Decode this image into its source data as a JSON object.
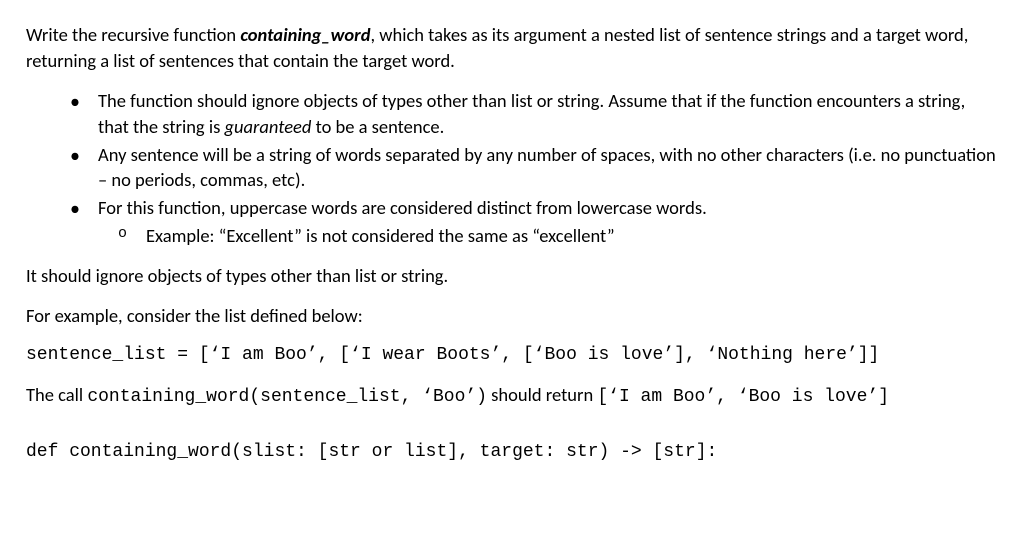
{
  "intro": {
    "pre": "Write the recursive function ",
    "fn_name": "containing_word",
    "post": ", which takes as its argument a nested list of sentence strings and a target word, returning a list of sentences that contain the target word."
  },
  "bullets": [
    {
      "pre": "The function should ignore objects of types other than list or string. Assume that if the function encounters a string, that the string is ",
      "italic": "guaranteed",
      "post": " to be a sentence."
    },
    {
      "text": "Any sentence will be a string of words separated by any number of spaces, with no other characters (i.e. no punctuation – no periods, commas, etc)."
    },
    {
      "text": "For this function, uppercase words are considered distinct from lowercase words.",
      "sub": "Example: “Excellent” is not considered the same as “excellent”"
    }
  ],
  "ignore_line": "It should ignore objects of types other than list or string.",
  "example_intro": "For example, consider the list defined below:",
  "code_def": "sentence_list = [‘I am Boo’, [‘I wear Boots’, [‘Boo is love’], ‘Nothing here’]]",
  "call_line": {
    "pre": "The call ",
    "call_code": "containing_word(sentence_list, ‘Boo’)",
    "mid": " should return ",
    "ret_code": "[‘I am Boo’, ‘Boo is love’]"
  },
  "fn_sig": "def containing_word(slist: [str or list], target: str) -> [str]:"
}
